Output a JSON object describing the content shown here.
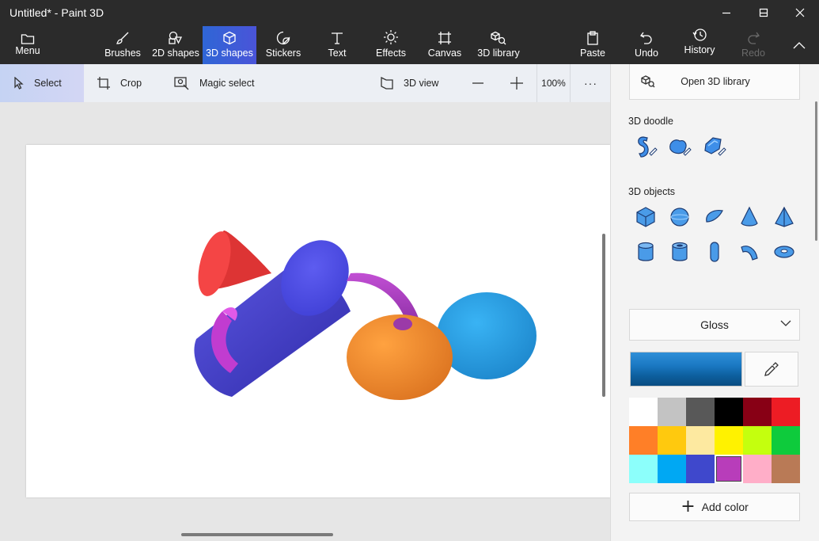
{
  "window": {
    "title": "Untitled* - Paint 3D"
  },
  "toolbar": {
    "menu": "Menu",
    "brushes": "Brushes",
    "shapes2d": "2D shapes",
    "shapes3d": "3D shapes",
    "stickers": "Stickers",
    "text": "Text",
    "effects": "Effects",
    "canvas": "Canvas",
    "library3d": "3D library",
    "paste": "Paste",
    "undo": "Undo",
    "history": "History",
    "redo": "Redo"
  },
  "subtoolbar": {
    "select": "Select",
    "crop": "Crop",
    "magic_select": "Magic select",
    "view3d": "3D view",
    "zoom": "100%",
    "more": "···"
  },
  "panel": {
    "open_library": "Open 3D library",
    "doodle_title": "3D doodle",
    "objects_title": "3D objects",
    "material": "Gloss",
    "add_color": "Add color",
    "palette": [
      "#ffffff",
      "#c3c3c3",
      "#585858",
      "#000000",
      "#880015",
      "#ed1c24",
      "#ff7f27",
      "#ffc90e",
      "#fde9a0",
      "#fff200",
      "#c4ff0e",
      "#0ecb3c",
      "#8cfffb",
      "#00a8f3",
      "#3f48cc",
      "#b83dba",
      "#ffaec8",
      "#b97a56"
    ],
    "selected_color": "#b83dba"
  },
  "icons": {
    "menu": "folder-icon",
    "brushes": "brush-icon",
    "shapes2d": "shapes-2d-icon",
    "shapes3d": "cube-icon",
    "stickers": "sticker-icon",
    "text": "text-icon",
    "effects": "sun-icon",
    "canvas": "crop-frame-icon",
    "library3d": "library-icon",
    "paste": "clipboard-icon",
    "undo": "undo-icon",
    "history": "history-icon",
    "redo": "redo-icon"
  }
}
